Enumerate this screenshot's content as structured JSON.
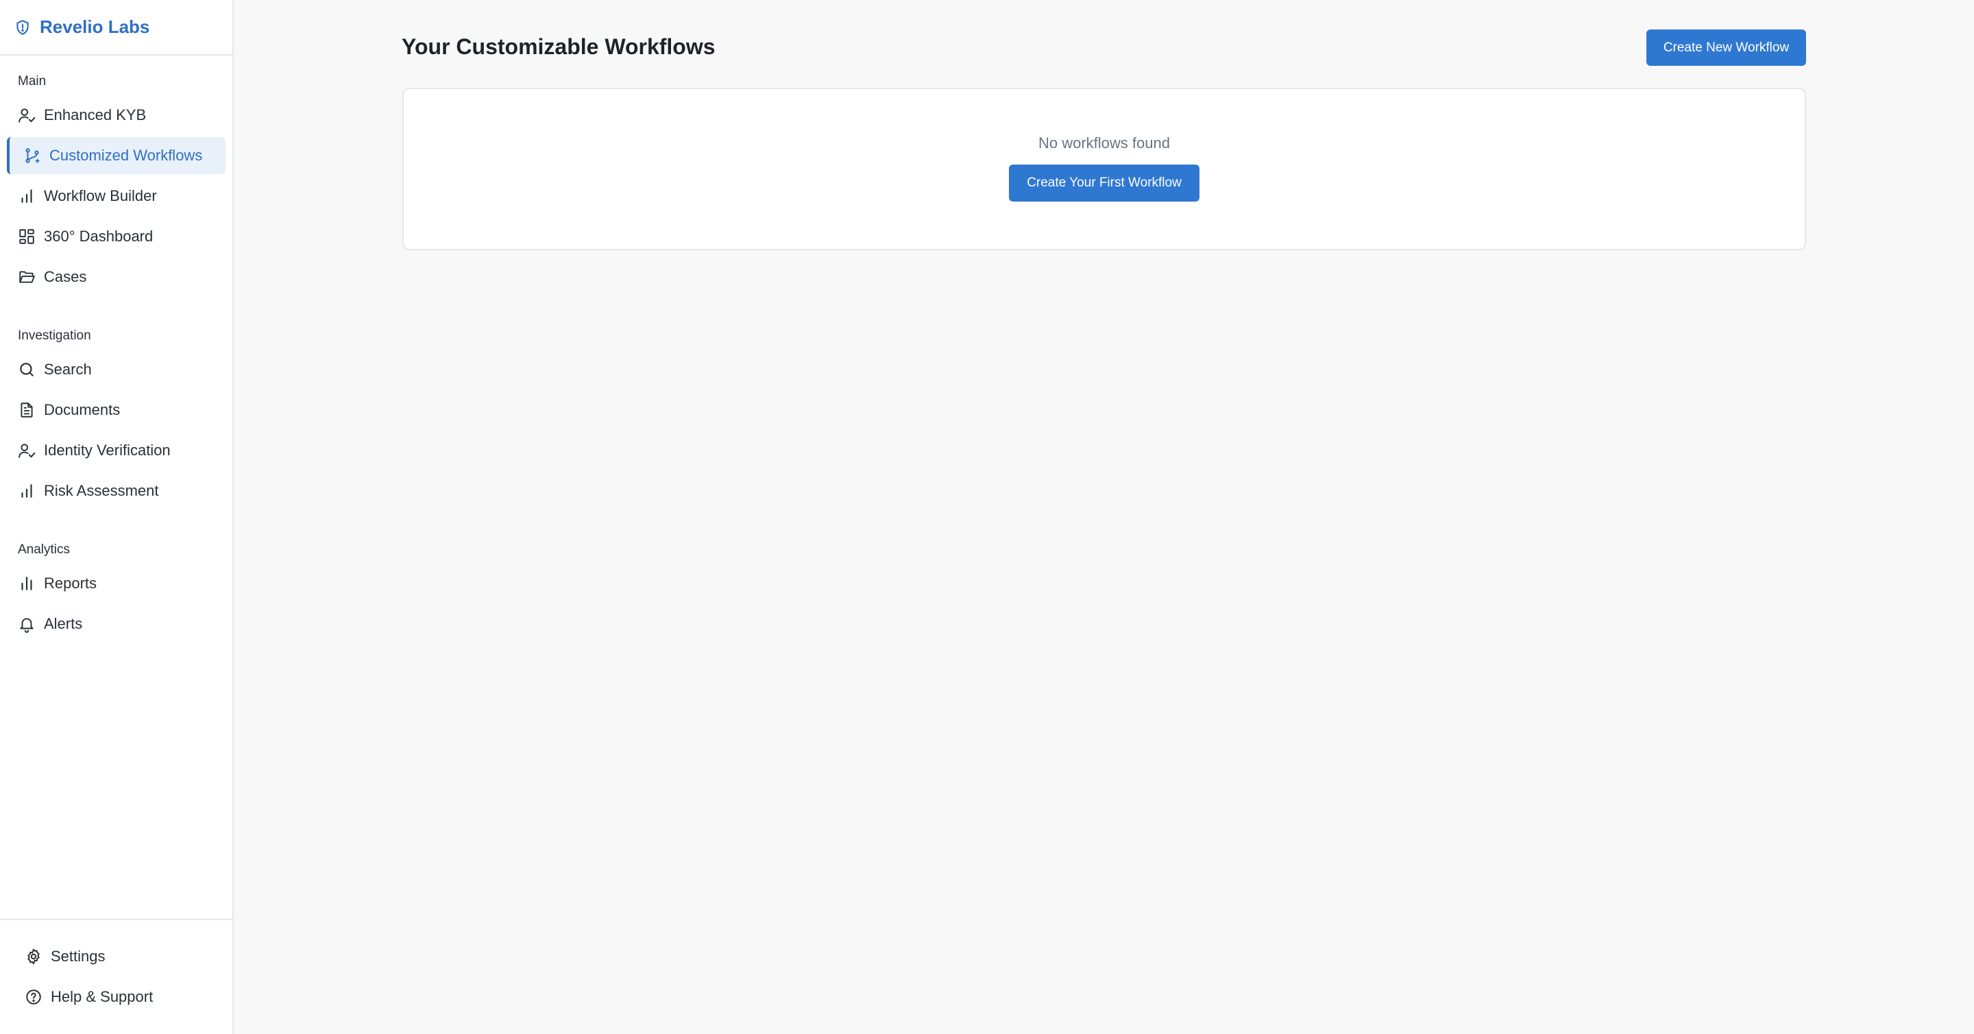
{
  "brand": {
    "name": "Revelio Labs",
    "icon": "shield-icon",
    "color": "#2f6fc7"
  },
  "sidebar": {
    "sections": [
      {
        "title": "Main",
        "items": [
          {
            "label": "Enhanced KYB",
            "icon": "user-check-icon"
          },
          {
            "label": "Customized Workflows",
            "icon": "git-branch-icon",
            "active": true
          },
          {
            "label": "Workflow Builder",
            "icon": "bar-chart-icon"
          },
          {
            "label": "360° Dashboard",
            "icon": "dashboard-grid-icon"
          },
          {
            "label": "Cases",
            "icon": "folder-open-icon"
          }
        ]
      },
      {
        "title": "Investigation",
        "items": [
          {
            "label": "Search",
            "icon": "search-icon"
          },
          {
            "label": "Documents",
            "icon": "document-icon"
          },
          {
            "label": "Identity Verification",
            "icon": "user-check-icon"
          },
          {
            "label": "Risk Assessment",
            "icon": "bar-chart-icon"
          }
        ]
      },
      {
        "title": "Analytics",
        "items": [
          {
            "label": "Reports",
            "icon": "bar-chart-icon"
          },
          {
            "label": "Alerts",
            "icon": "bell-icon"
          }
        ]
      }
    ],
    "footer": [
      {
        "label": "Settings",
        "icon": "gear-icon"
      },
      {
        "label": "Help & Support",
        "icon": "help-circle-icon"
      }
    ]
  },
  "main": {
    "title": "Your Customizable Workflows",
    "create_button": "Create New Workflow",
    "empty_state": {
      "message": "No workflows found",
      "button": "Create Your First Workflow"
    }
  },
  "colors": {
    "accent": "#2f6fc7",
    "button": "#2f78d1",
    "active_bg": "#e8f0fa"
  }
}
